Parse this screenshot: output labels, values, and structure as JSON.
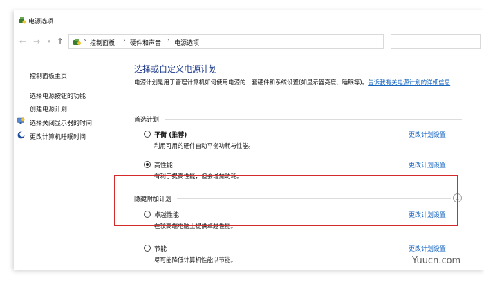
{
  "window": {
    "title": "电源选项"
  },
  "navbar": {
    "breadcrumbs": [
      "控制面板",
      "硬件和声音",
      "电源选项"
    ]
  },
  "sidebar": {
    "items": [
      {
        "label": "控制面板主页",
        "icon": ""
      },
      {
        "label": "选择电源按钮的功能",
        "icon": ""
      },
      {
        "label": "创建电源计划",
        "icon": ""
      },
      {
        "label": "选择关闭显示器的时间",
        "icon": "monitor-shield-icon"
      },
      {
        "label": "更改计算机睡眠时间",
        "icon": "moon-icon"
      }
    ]
  },
  "main": {
    "title": "选择或自定义电源计划",
    "description": "电源计划是用于管理计算机如何使用电源的一套硬件和系统设置(如显示器亮度、睡眠等)。",
    "description_link": "告诉我有关电源计划的详细信息",
    "preferred_section": "首选计划",
    "hidden_section": "隐藏附加计划",
    "change_label": "更改计划设置",
    "plans": [
      {
        "name": "平衡 (推荐)",
        "desc": "利用可用的硬件自动平衡功耗与性能。",
        "checked": false
      },
      {
        "name": "高性能",
        "desc": "有利于提高性能，但会增加功耗。",
        "checked": true
      },
      {
        "name": "卓越性能",
        "desc": "在较高端电脑上提供卓越性能。",
        "checked": false
      },
      {
        "name": "节能",
        "desc": "尽可能降低计算机性能以节能。",
        "checked": false
      }
    ]
  },
  "colors": {
    "link": "#1565c0",
    "title": "#1e3a8a",
    "highlight": "#d42a2a"
  },
  "watermark": "Yuucn.com"
}
